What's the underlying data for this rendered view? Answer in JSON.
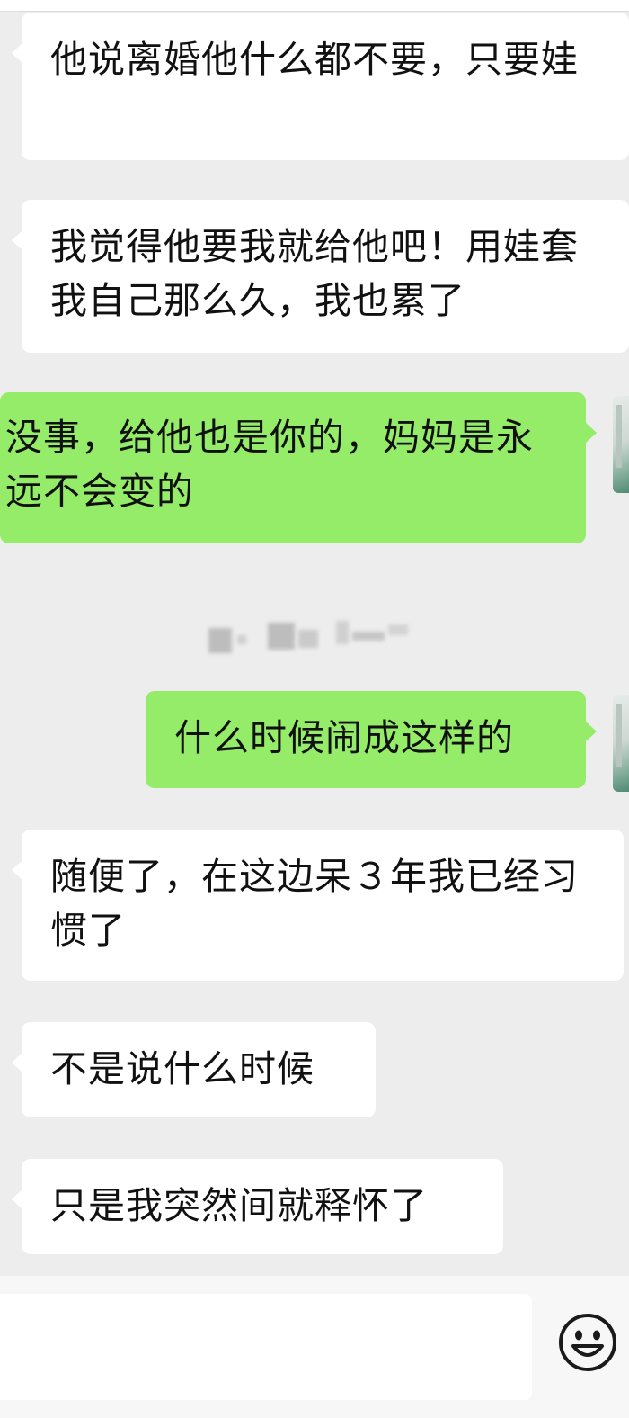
{
  "messages": [
    {
      "side": "in",
      "text": "他说离婚他什么都不要，只要娃"
    },
    {
      "side": "in",
      "text": "我觉得他要我就给他吧！用娃套我自己那么久，我也累了"
    },
    {
      "side": "out",
      "text": "没事，给他也是你的，妈妈是永远不会变的"
    },
    {
      "side": "out",
      "text": "什么时候闹成这样的"
    },
    {
      "side": "in",
      "text": "随便了，在这边呆３年我已经习惯了"
    },
    {
      "side": "in",
      "text": "不是说什么时候"
    },
    {
      "side": "in",
      "text": "只是我突然间就释怀了"
    }
  ],
  "timestamp": {
    "state": "blurred"
  },
  "input_bar": {
    "emoji_icon": "smiley-face-icon",
    "input_value": ""
  },
  "colors": {
    "background": "#ededed",
    "incoming_bubble": "#ffffff",
    "outgoing_bubble": "#95ec69",
    "text": "#111111"
  }
}
